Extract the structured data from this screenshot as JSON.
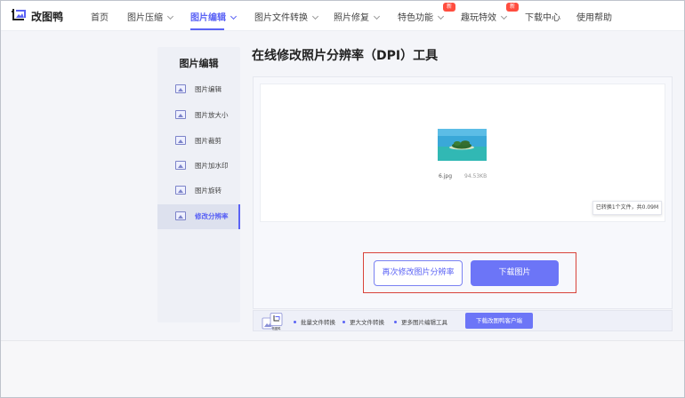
{
  "brand": {
    "name": "改图鸭"
  },
  "nav": {
    "items": [
      {
        "label": "首页",
        "dropdown": false,
        "badge": ""
      },
      {
        "label": "图片压缩",
        "dropdown": true,
        "badge": ""
      },
      {
        "label": "图片编辑",
        "dropdown": true,
        "badge": "",
        "active": true
      },
      {
        "label": "图片文件转换",
        "dropdown": true,
        "badge": ""
      },
      {
        "label": "照片修复",
        "dropdown": true,
        "badge": ""
      },
      {
        "label": "特色功能",
        "dropdown": true,
        "badge": "新"
      },
      {
        "label": "趣玩特效",
        "dropdown": true,
        "badge": "新"
      },
      {
        "label": "下载中心",
        "dropdown": false,
        "badge": ""
      },
      {
        "label": "使用帮助",
        "dropdown": false,
        "badge": ""
      }
    ]
  },
  "sidebar": {
    "title": "图片编辑",
    "items": [
      {
        "label": "图片编辑",
        "icon": "image-icon"
      },
      {
        "label": "图片放大小",
        "icon": "image-icon"
      },
      {
        "label": "图片裁剪",
        "icon": "image-icon"
      },
      {
        "label": "图片加水印",
        "icon": "image-icon"
      },
      {
        "label": "图片旋转",
        "icon": "image-icon"
      },
      {
        "label": "修改分辨率",
        "icon": "image-icon",
        "active": true
      }
    ]
  },
  "main": {
    "title": "在线修改照片分辨率（DPI）工具",
    "file": {
      "name": "6.jpg",
      "size": "94.53KB"
    },
    "summary": "已转换1个文件，共0.09M",
    "buttons": {
      "redo": "再次修改图片分辨率",
      "download": "下载图片"
    }
  },
  "bottom_bar": {
    "app_icon_label": "改图鸭",
    "features": [
      "批量文件转换",
      "更大文件转换",
      "更多图片编辑工具"
    ],
    "download_client": "下载改图鸭客户端"
  },
  "colors": {
    "accent": "#5b63f5",
    "button": "#6c75f7",
    "badge": "#ff4d3f",
    "highlight": "#d9433a"
  }
}
